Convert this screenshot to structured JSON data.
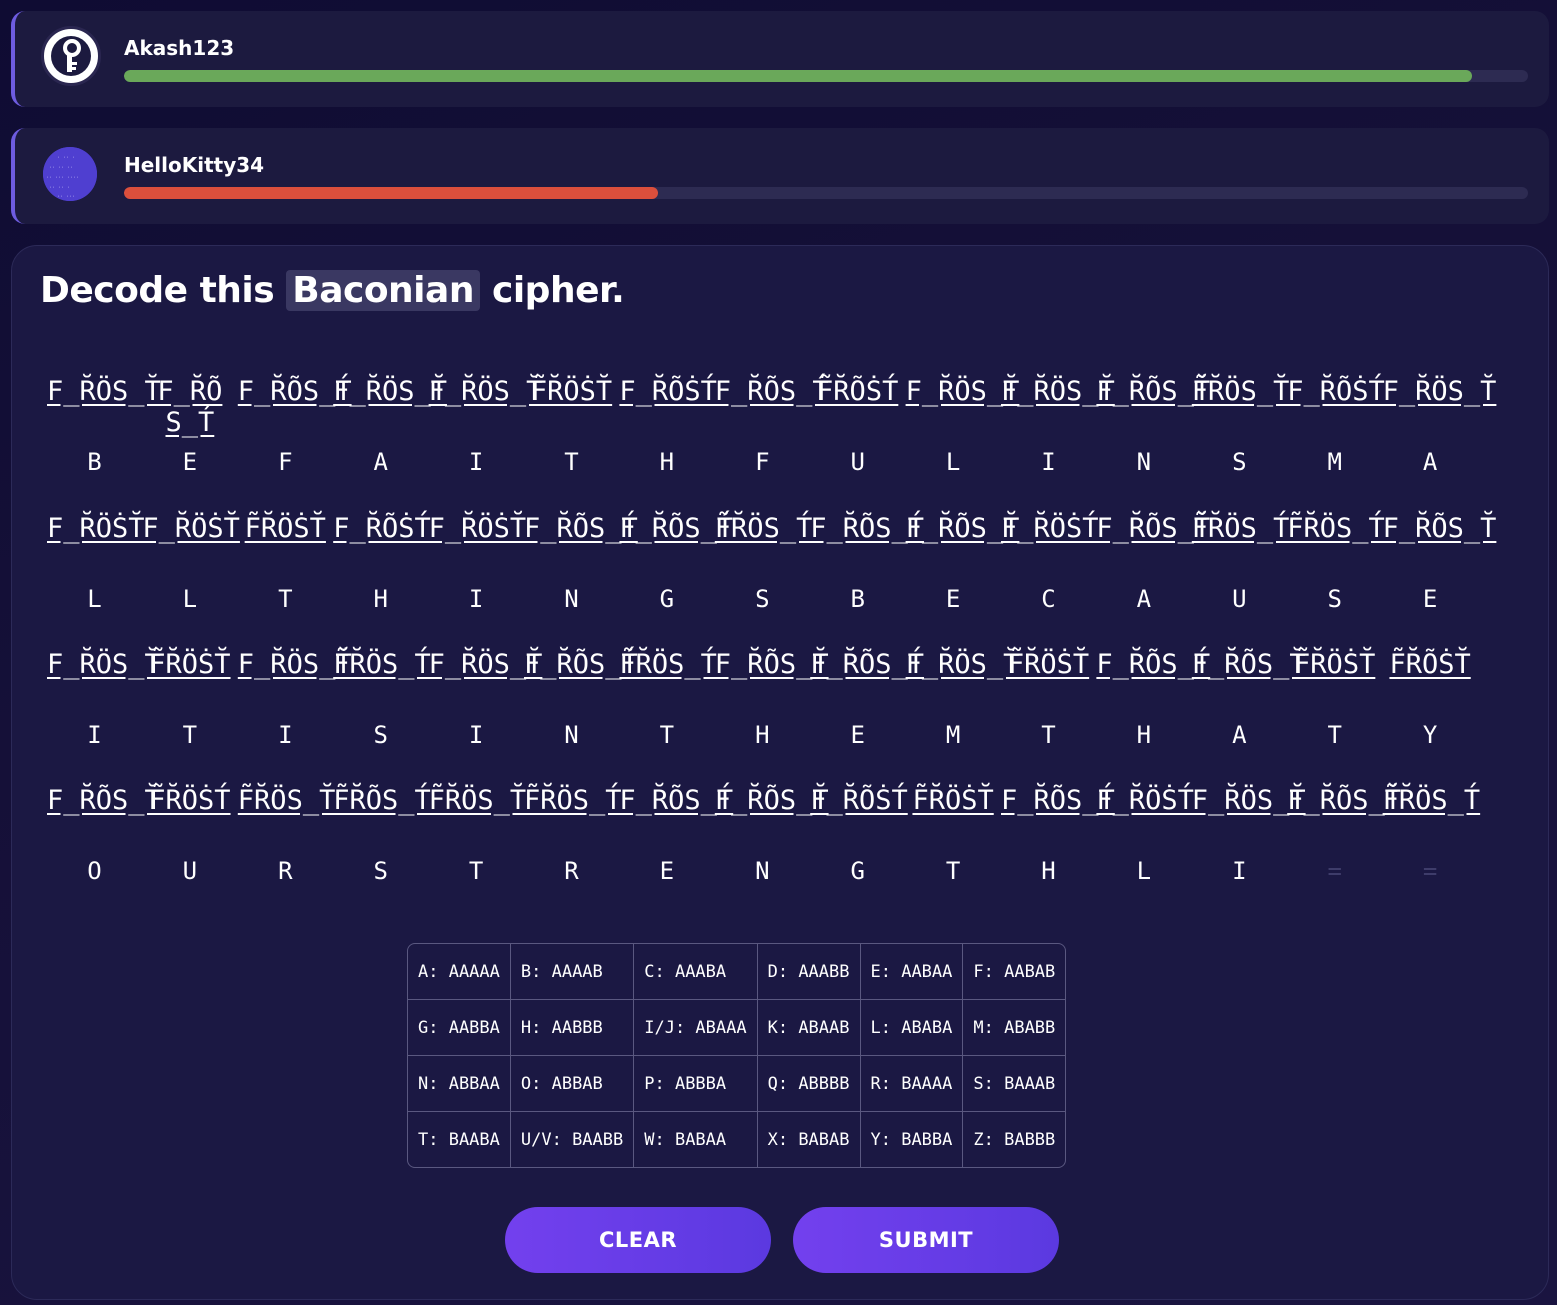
{
  "players": [
    {
      "name": "Akash123",
      "progress": 0.96,
      "color": "#6aa85a",
      "avatar": "key-avatar"
    },
    {
      "name": "HelloKitty34",
      "progress": 0.38,
      "color": "#db4f3c",
      "avatar": "cipher-text-avatar"
    }
  ],
  "question": {
    "prefix": "Decode this",
    "highlight": "Baconian",
    "suffix": "cipher."
  },
  "rows": [
    {
      "words": [
        "F̲R̆ÖS̲T̆",
        "F̲R̆Õ S̲T́",
        "F̲R̆ÕS̲T́",
        "F̲R̆ÖS̲T̆",
        "F̲R̆ÖS̲T̆",
        "F̃R̆ÖṠT̆",
        "F̲R̆ÕṠT́",
        "F̲R̆ÕS̲T́",
        "F̃R̆ÕṠT́",
        "F̲R̆ÖS̲T̆",
        "F̲R̆ÖS̲T̆",
        "F̲R̆ÕS̲T̆",
        "F̃R̆ÖS̲T̆",
        "F̲R̆ÕṠT́",
        "F̲R̆ÖS̲T̆"
      ],
      "letters": [
        "B",
        "E",
        "F",
        "A",
        "I",
        "T",
        "H",
        "F",
        "U",
        "L",
        "I",
        "N",
        "S",
        "M",
        "A"
      ]
    },
    {
      "words": [
        "F̲R̆ÖṠT̆",
        "F̲R̆ÖṠT̆",
        "F̃R̆ÖṠT̆",
        "F̲R̆ÕṠT́",
        "F̲R̆ÖṠT̆",
        "F̲R̆ÕS̲T́",
        "F̲R̆ÕS̲T́",
        "F̃R̆ÖS̲T́",
        "F̲R̆ÕS̲T́",
        "F̲R̆ÕS̲T̆",
        "F̲R̆ÖṠT́",
        "F̲R̆ÕS̲T̆",
        "F̃R̆ÖS̲T́",
        "F̃R̆ÖS̲T́",
        "F̲R̆ÕS̲T̆"
      ],
      "letters": [
        "L",
        "L",
        "T",
        "H",
        "I",
        "N",
        "G",
        "S",
        "B",
        "E",
        "C",
        "A",
        "U",
        "S",
        "E"
      ]
    },
    {
      "words": [
        "F̲R̆ÖS̲T̆",
        "F̃R̆ÖṠT̆",
        "F̲R̆ÖS̲T̆",
        "F̃R̆ÖS̲T́",
        "F̲R̆ÖS̲T̆",
        "F̲R̆ÕS̲T́",
        "F̃R̆ÖS̲T́",
        "F̲R̆ÕS̲T̆",
        "F̲R̆ÕS̲T́",
        "F̲R̆ÖS̲T̆",
        "F̃R̆ÖṠT̆",
        "F̲R̆ÕS̲T́",
        "F̲R̆ÕS̲T̆",
        "F̃R̆ÖṠT̆",
        "F̃R̆ÕṠT̆"
      ],
      "letters": [
        "I",
        "T",
        "I",
        "S",
        "I",
        "N",
        "T",
        "H",
        "E",
        "M",
        "T",
        "H",
        "A",
        "T",
        "Y"
      ]
    },
    {
      "words": [
        "F̲R̆ÕS̲T̆",
        "F̃R̆ÖṠT́",
        "F̃R̆ÖS̲T̆",
        "F̃R̆ÕS̲T́",
        "F̃R̆ÖS̲T̆",
        "F̃R̆ÖS̲T́",
        "F̲R̆ÕS̲T́",
        "F̲R̆ÕS̲T̆",
        "F̲R̆ÕṠT́",
        "F̃R̆ÖṠT̆",
        "F̲R̆ÕS̲T́",
        "F̲R̆ÖṠT́",
        "F̲R̆ÖS̲T̆",
        "F̲R̆ÕS̲T̆",
        "F̃R̆ÖS̲T́"
      ],
      "letters": [
        "O",
        "U",
        "R",
        "S",
        "T",
        "R",
        "E",
        "N",
        "G",
        "T",
        "H",
        "L",
        "I",
        "=",
        "="
      ]
    }
  ],
  "key_table": [
    [
      "A: AAAAA",
      "B: AAAAB",
      "C: AAABA",
      "D: AAABB",
      "E: AABAA",
      "F: AABAB"
    ],
    [
      "G: AABBA",
      "H: AABBB",
      "I/J: ABAAA",
      "K: ABAAB",
      "L: ABABA",
      "M: ABABB"
    ],
    [
      "N: ABBAA",
      "O: ABBAB",
      "P: ABBBA",
      "Q: ABBBB",
      "R: BAAAA",
      "S: BAAAB"
    ],
    [
      "T: BAABA",
      "U/V: BAABB",
      "W: BABAA",
      "X: BABAB",
      "Y: BABBA",
      "Z: BABBB"
    ]
  ],
  "buttons": {
    "clear": "CLEAR",
    "submit": "SUBMIT"
  }
}
